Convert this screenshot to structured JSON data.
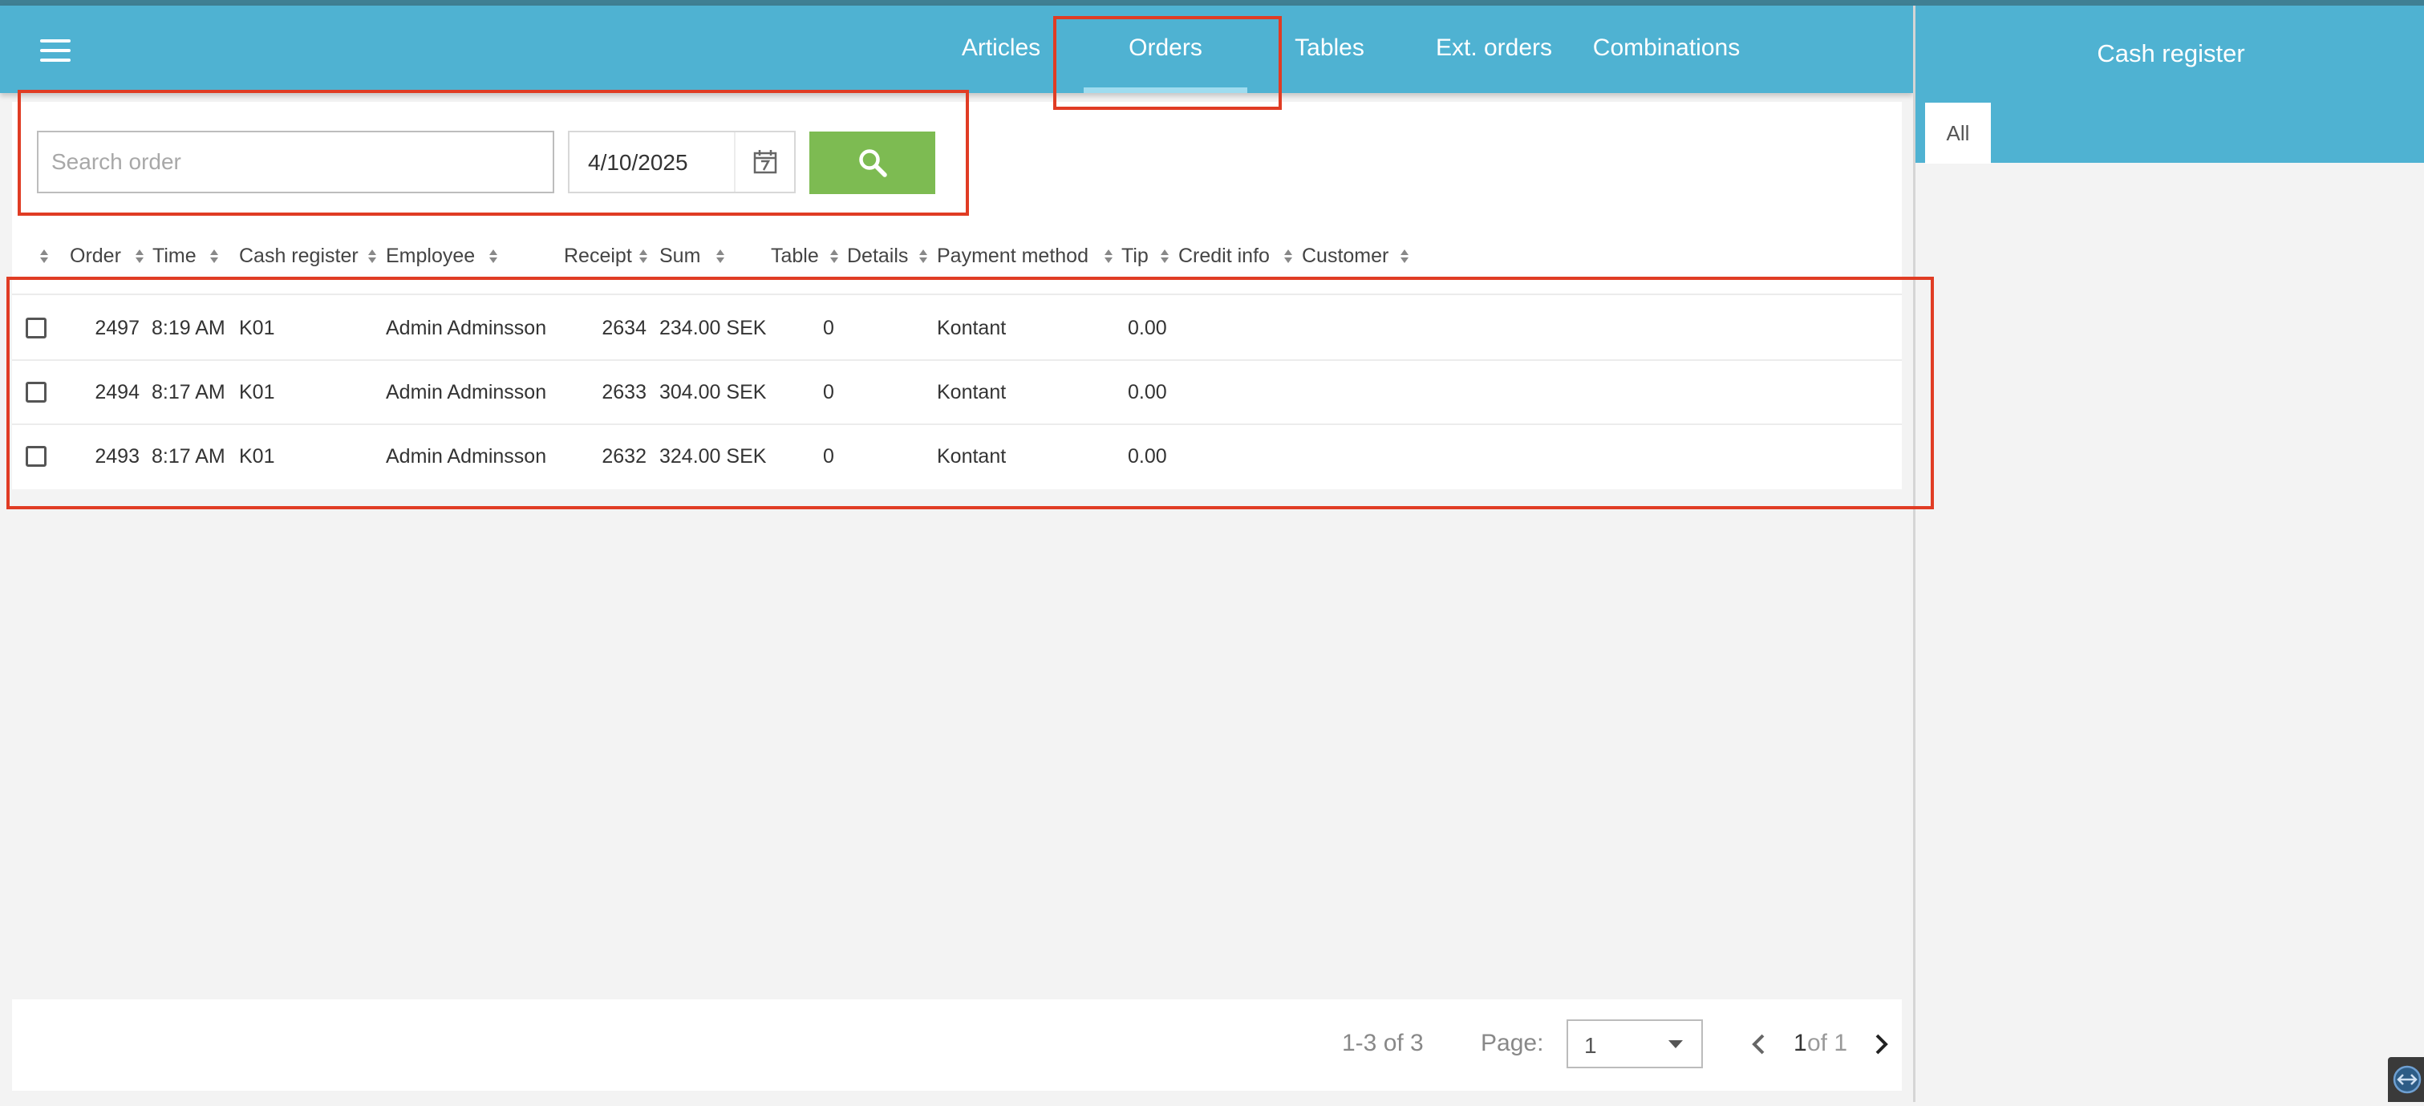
{
  "nav": {
    "tabs": [
      "Articles",
      "Orders",
      "Tables",
      "Ext. orders",
      "Combinations"
    ],
    "active_tab": "Orders"
  },
  "side_panel": {
    "title": "Cash register",
    "tab_all": "All"
  },
  "search": {
    "placeholder": "Search order",
    "date": "4/10/2025"
  },
  "table": {
    "columns": [
      "Order",
      "Time",
      "Cash register",
      "Employee",
      "Receipt",
      "Sum",
      "Table",
      "Details",
      "Payment method",
      "Tip",
      "Credit info",
      "Customer"
    ],
    "rows": [
      {
        "order": "2497",
        "time": "8:19 AM",
        "cash_register": "K01",
        "employee": "Admin Adminsson",
        "receipt": "2634",
        "sum": "234.00 SEK",
        "table": "0",
        "details": "",
        "payment_method": "Kontant",
        "tip": "0.00",
        "credit_info": "",
        "customer": ""
      },
      {
        "order": "2494",
        "time": "8:17 AM",
        "cash_register": "K01",
        "employee": "Admin Adminsson",
        "receipt": "2633",
        "sum": "304.00 SEK",
        "table": "0",
        "details": "",
        "payment_method": "Kontant",
        "tip": "0.00",
        "credit_info": "",
        "customer": ""
      },
      {
        "order": "2493",
        "time": "8:17 AM",
        "cash_register": "K01",
        "employee": "Admin Adminsson",
        "receipt": "2632",
        "sum": "324.00 SEK",
        "table": "0",
        "details": "",
        "payment_method": "Kontant",
        "tip": "0.00",
        "credit_info": "",
        "customer": ""
      }
    ]
  },
  "pagination": {
    "range": "1-3 of 3",
    "page_label": "Page:",
    "page_select": "1",
    "current": "1",
    "of_total": "of 1"
  },
  "colors": {
    "header": "#4fb2d2",
    "search_button": "#7dbb52",
    "highlight": "#e03c24"
  }
}
